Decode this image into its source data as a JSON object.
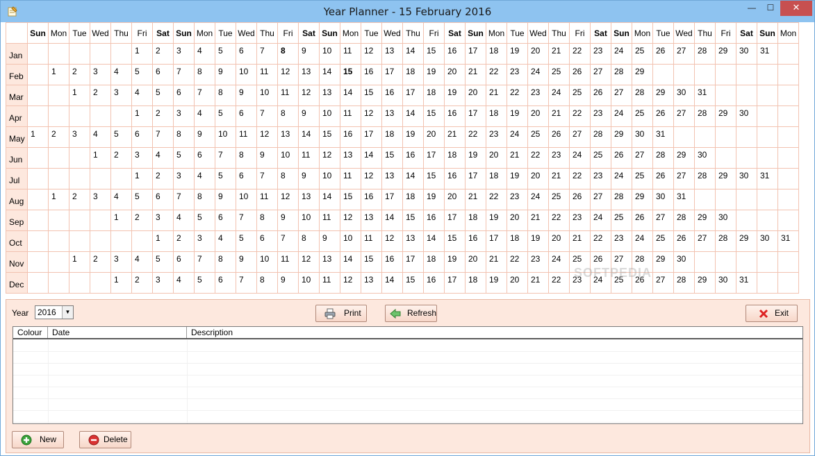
{
  "window": {
    "title": "Year Planner - 15 February 2016",
    "min_glyph": "—",
    "max_glyph": "☐",
    "close_glyph": "✕"
  },
  "calendar": {
    "weekday_headers": [
      "Sun",
      "Mon",
      "Tue",
      "Wed",
      "Thu",
      "Fri",
      "Sat",
      "Sun",
      "Mon",
      "Tue",
      "Wed",
      "Thu",
      "Fri",
      "Sat",
      "Sun",
      "Mon",
      "Tue",
      "Wed",
      "Thu",
      "Fri",
      "Sat",
      "Sun",
      "Mon",
      "Tue",
      "Wed",
      "Thu",
      "Fri",
      "Sat",
      "Sun",
      "Mon",
      "Tue",
      "Wed",
      "Thu",
      "Fri",
      "Sat",
      "Sun",
      "Mon"
    ],
    "bold_weekdays": [
      "Sun",
      "Sat"
    ],
    "months": [
      {
        "label": "Jan",
        "offset": 5,
        "days": 31,
        "bold_day": 8
      },
      {
        "label": "Feb",
        "offset": 1,
        "days": 29,
        "bold_day": 15
      },
      {
        "label": "Mar",
        "offset": 2,
        "days": 31,
        "bold_day": 0
      },
      {
        "label": "Apr",
        "offset": 5,
        "days": 30,
        "bold_day": 0
      },
      {
        "label": "May",
        "offset": 0,
        "days": 31,
        "bold_day": 0
      },
      {
        "label": "Jun",
        "offset": 3,
        "days": 30,
        "bold_day": 0
      },
      {
        "label": "Jul",
        "offset": 5,
        "days": 31,
        "bold_day": 0
      },
      {
        "label": "Aug",
        "offset": 1,
        "days": 31,
        "bold_day": 0
      },
      {
        "label": "Sep",
        "offset": 4,
        "days": 30,
        "bold_day": 0
      },
      {
        "label": "Oct",
        "offset": 6,
        "days": 31,
        "bold_day": 0
      },
      {
        "label": "Nov",
        "offset": 2,
        "days": 30,
        "bold_day": 0
      },
      {
        "label": "Dec",
        "offset": 4,
        "days": 31,
        "bold_day": 0
      }
    ],
    "watermark": "SOFTPEDIA"
  },
  "controls": {
    "year_label": "Year",
    "year_value": "2016",
    "print_label": "Print",
    "refresh_label": "Refresh",
    "exit_label": "Exit",
    "new_label": "New",
    "delete_label": "Delete"
  },
  "events_table": {
    "columns": [
      "Colour",
      "Date",
      "Description"
    ],
    "rows": []
  },
  "colors": {
    "titlebar": "#8ec3f0",
    "panel": "#fde8de",
    "grid_line": "#f2c2b0",
    "close_button": "#c75050"
  }
}
